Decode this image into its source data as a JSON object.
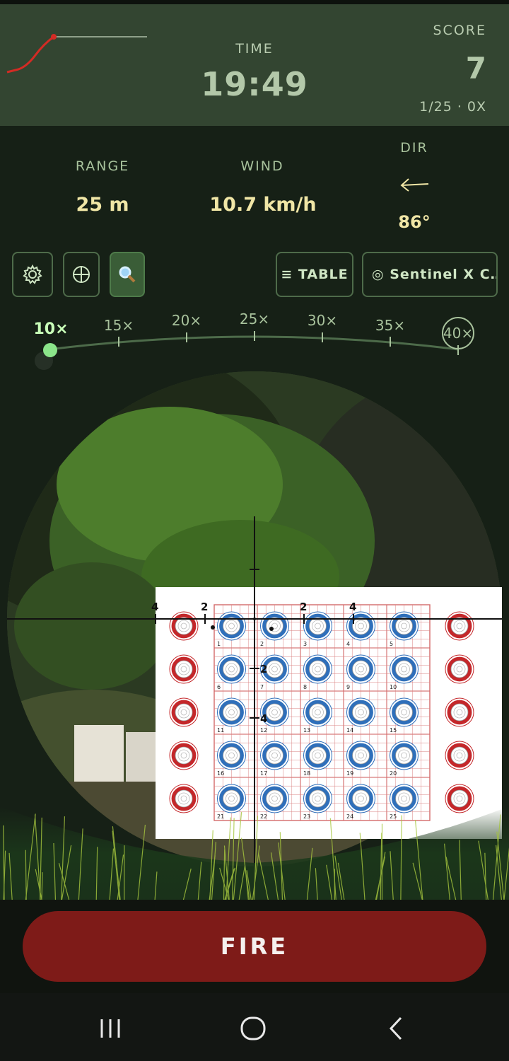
{
  "header": {
    "time_label": "TIME",
    "time_value": "19:49",
    "score_label": "SCORE",
    "score_value": "7",
    "score_sub": "1/25 · 0X",
    "trend_icon": "trend-line-icon"
  },
  "stats": {
    "range_label": "RANGE",
    "range_value": "25 m",
    "wind_label": "WIND",
    "wind_value": "10.7 km/h",
    "dir_label": "DIR",
    "dir_value": "86°",
    "dir_icon": "arrow-left-icon"
  },
  "toolbar": {
    "settings_icon": "gear-icon",
    "reticle_icon": "crosshair-icon",
    "zoom_icon": "magnifier-icon",
    "table_label": "≡ TABLE",
    "scope_label": "◎ Sentinel X C…"
  },
  "zoom": {
    "levels": [
      "10×",
      "15×",
      "20×",
      "25×",
      "30×",
      "35×",
      "40×"
    ],
    "selected": "10×"
  },
  "target": {
    "row_numbers": [
      "1",
      "2",
      "3",
      "4",
      "5",
      "6",
      "7",
      "8",
      "9",
      "10",
      "11",
      "12",
      "13",
      "14",
      "15",
      "16",
      "17",
      "18",
      "19",
      "20",
      "21",
      "22",
      "23",
      "24",
      "25"
    ],
    "reticle_marks": [
      "4",
      "2",
      "2",
      "4",
      "2",
      "4"
    ]
  },
  "fire": {
    "label": "FIRE"
  },
  "colors": {
    "accent": "#7e1b18",
    "header": "#334531",
    "bg": "#162016",
    "value": "#f0e6a6"
  },
  "navbar": {
    "icons": [
      "recents-icon",
      "home-icon",
      "back-icon"
    ]
  }
}
